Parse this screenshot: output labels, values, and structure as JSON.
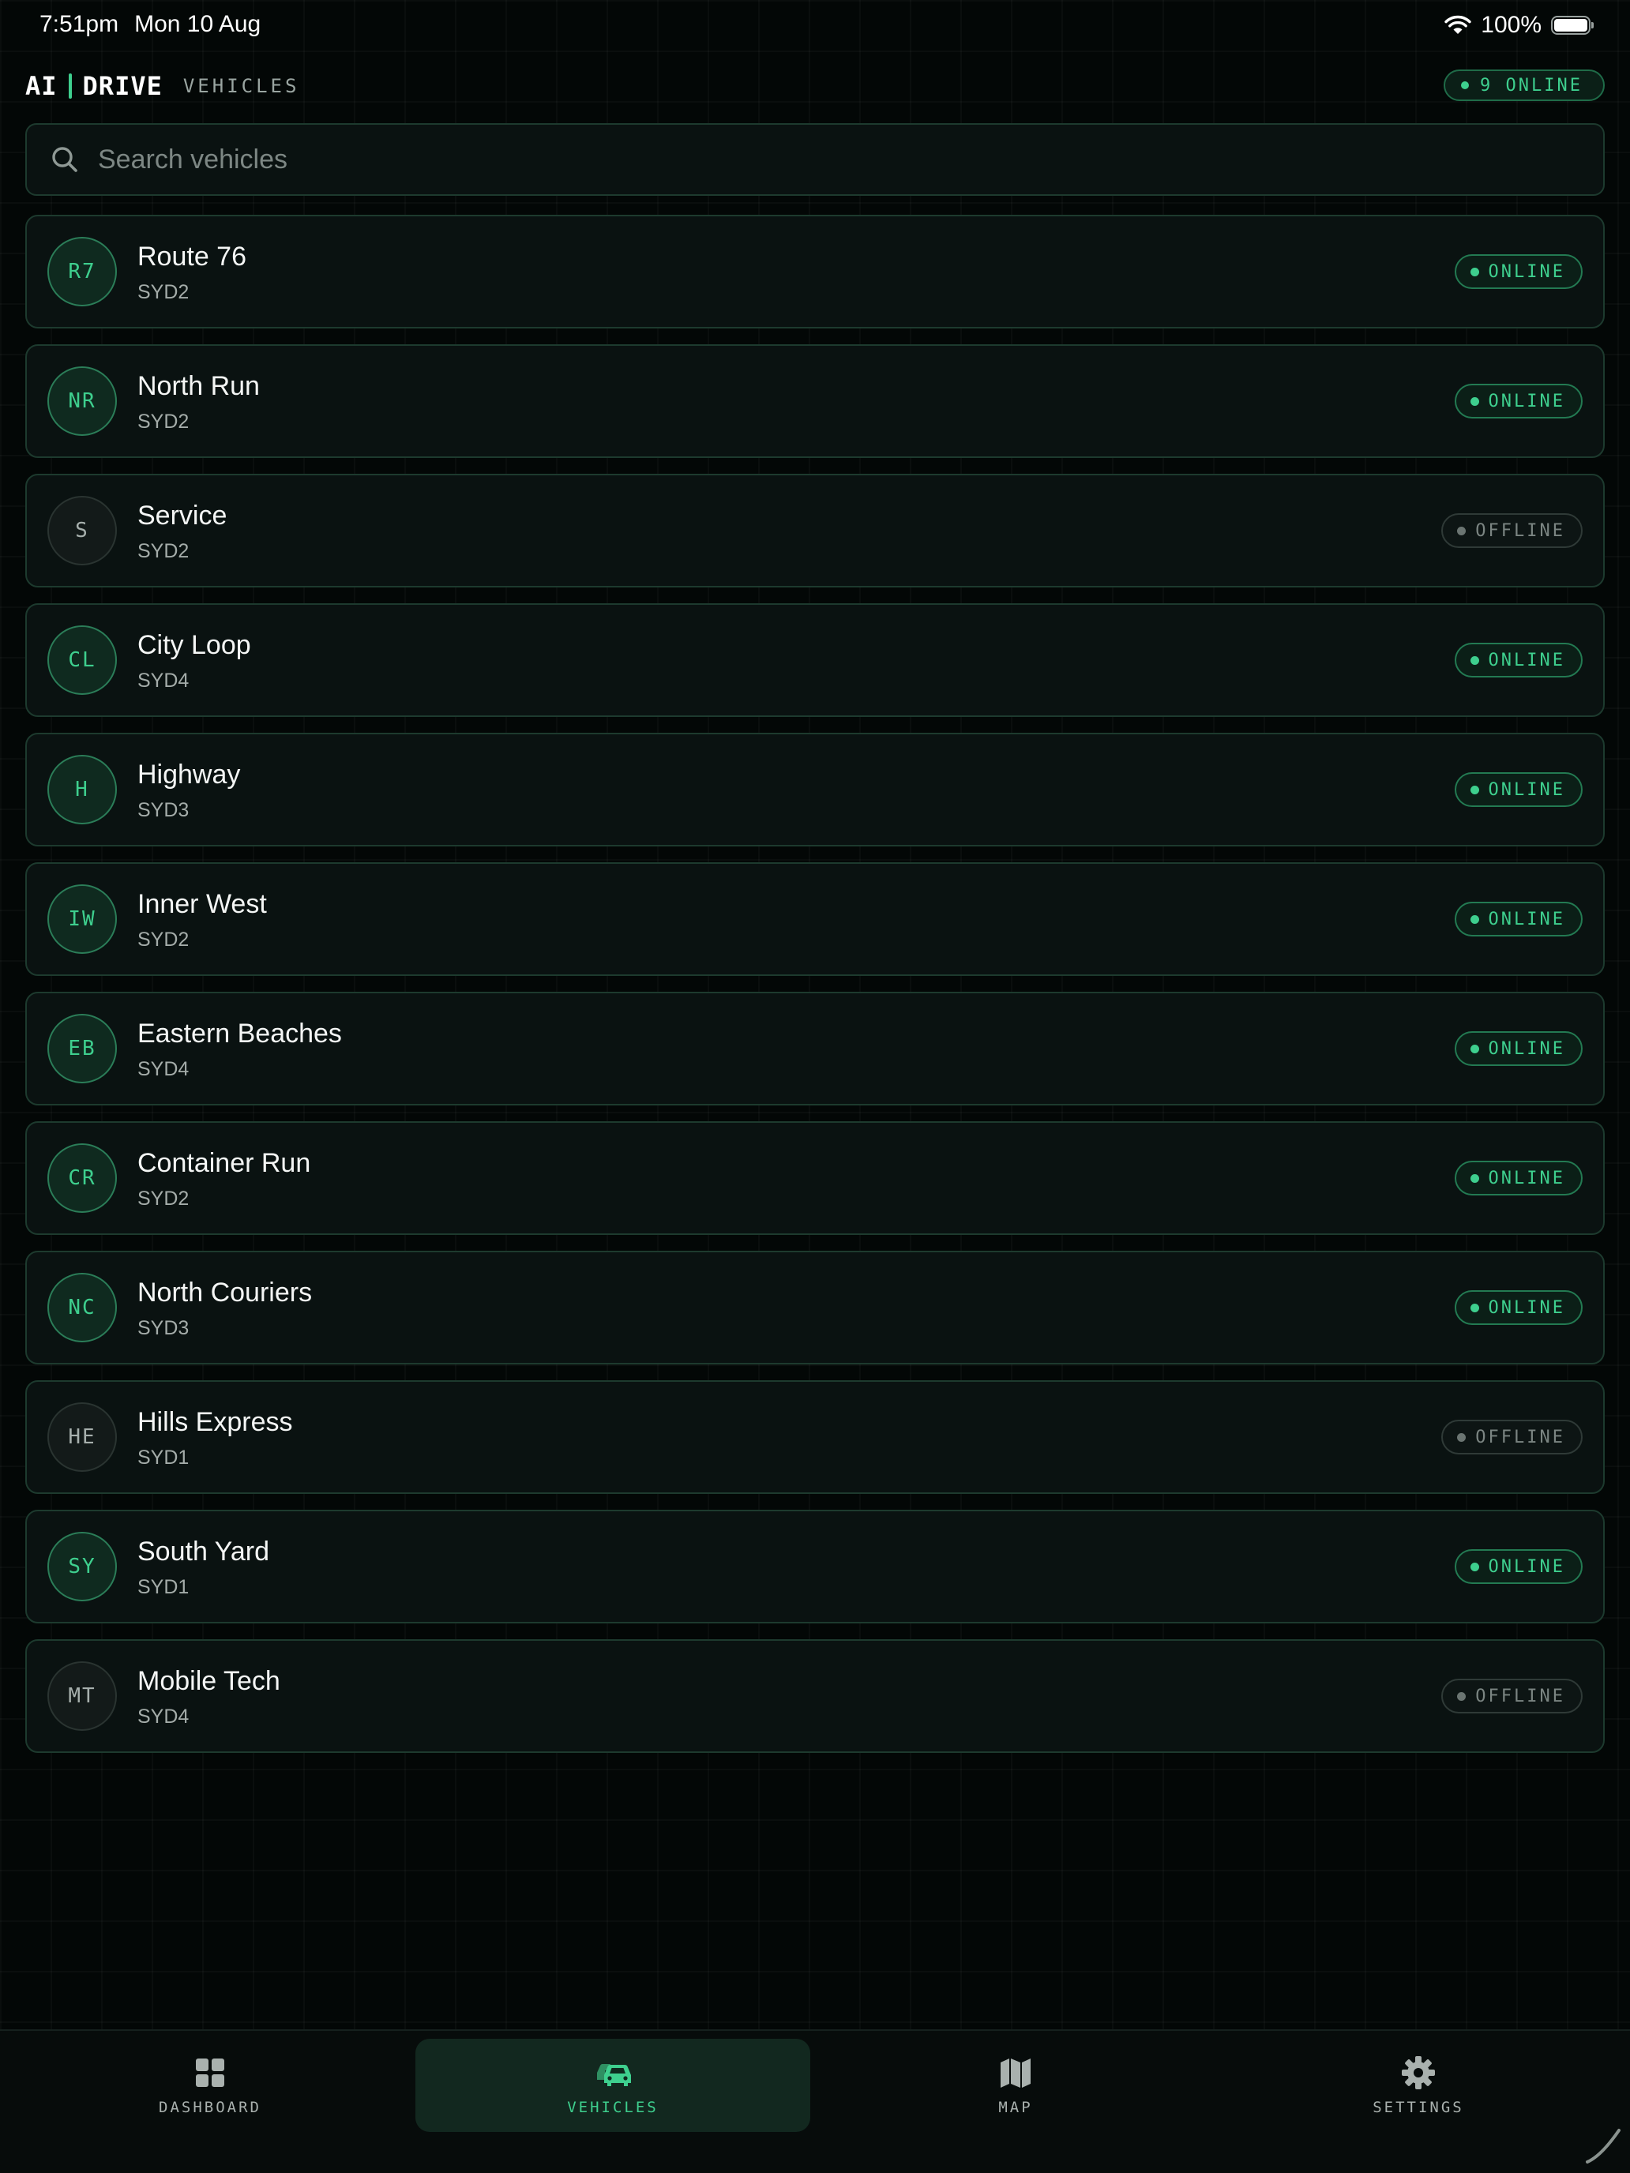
{
  "status_bar": {
    "time": "7:51pm",
    "date": "Mon 10 Aug",
    "battery": "100%",
    "wifi_icon": "wifi-icon",
    "battery_icon": "battery-icon"
  },
  "header": {
    "brand_left": "AI",
    "brand_right": "DRIVE",
    "section": "VEHICLES",
    "online_count": "9 ONLINE"
  },
  "search": {
    "placeholder": "Search vehicles",
    "value": "",
    "icon": "search-icon"
  },
  "vehicles": [
    {
      "initials": "R7",
      "name": "Route 76",
      "depot": "SYD2",
      "status": "ONLINE"
    },
    {
      "initials": "NR",
      "name": "North Run",
      "depot": "SYD2",
      "status": "ONLINE"
    },
    {
      "initials": "S",
      "name": "Service",
      "depot": "SYD2",
      "status": "OFFLINE"
    },
    {
      "initials": "CL",
      "name": "City Loop",
      "depot": "SYD4",
      "status": "ONLINE"
    },
    {
      "initials": "H",
      "name": "Highway",
      "depot": "SYD3",
      "status": "ONLINE"
    },
    {
      "initials": "IW",
      "name": "Inner West",
      "depot": "SYD2",
      "status": "ONLINE"
    },
    {
      "initials": "EB",
      "name": "Eastern Beaches",
      "depot": "SYD4",
      "status": "ONLINE"
    },
    {
      "initials": "CR",
      "name": "Container Run",
      "depot": "SYD2",
      "status": "ONLINE"
    },
    {
      "initials": "NC",
      "name": "North Couriers",
      "depot": "SYD3",
      "status": "ONLINE"
    },
    {
      "initials": "HE",
      "name": "Hills Express",
      "depot": "SYD1",
      "status": "OFFLINE"
    },
    {
      "initials": "SY",
      "name": "South Yard",
      "depot": "SYD1",
      "status": "ONLINE"
    },
    {
      "initials": "MT",
      "name": "Mobile Tech",
      "depot": "SYD4",
      "status": "OFFLINE"
    }
  ],
  "tabs": [
    {
      "label": "DASHBOARD",
      "icon": "grid-icon",
      "active": false
    },
    {
      "label": "VEHICLES",
      "icon": "cars-icon",
      "active": true
    },
    {
      "label": "MAP",
      "icon": "map-icon",
      "active": false
    },
    {
      "label": "SETTINGS",
      "icon": "gear-icon",
      "active": false
    }
  ],
  "colors": {
    "accent": "#3ecf8e",
    "background": "#030706",
    "card": "#0a1211",
    "offline": "#7b8582"
  }
}
